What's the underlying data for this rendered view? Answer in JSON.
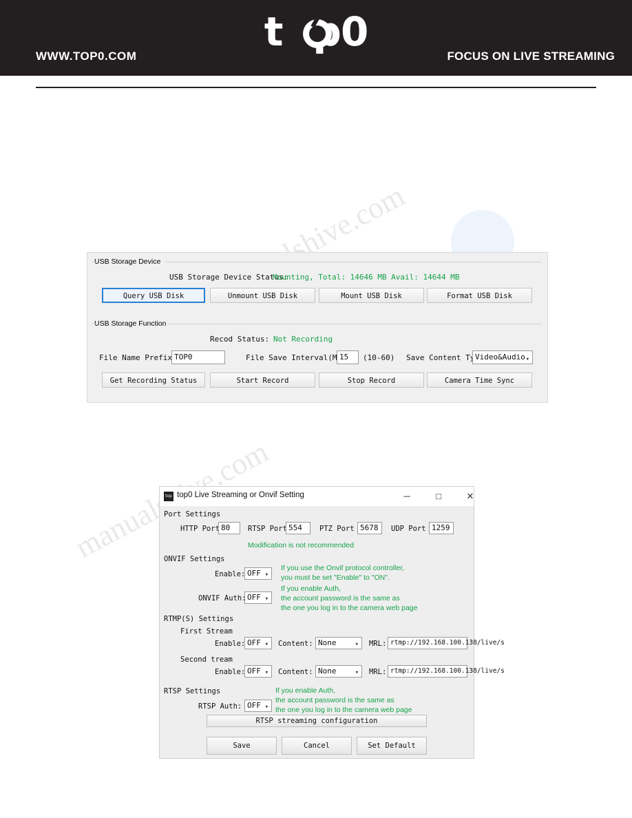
{
  "header": {
    "url": "WWW.TOP0.COM",
    "tagline": "FOCUS ON LIVE STREAMING",
    "logo_left": "t",
    "logo_right": "p0"
  },
  "watermark": {
    "line1": "alshive.com",
    "line2": "manualshive.com"
  },
  "usb_panel": {
    "group1_label": "USB Storage Device",
    "status_label": "USB Storage Device Status:",
    "status_value": "Mounting,  Total:  14646 MB  Avail:  14644 MB",
    "status_color": "#16a34a",
    "buttons": [
      {
        "label": "Query USB Disk",
        "primary": true
      },
      {
        "label": "Unmount USB Disk",
        "primary": false
      },
      {
        "label": "Mount USB Disk",
        "primary": false
      },
      {
        "label": "Format USB Disk",
        "primary": false
      }
    ],
    "group2_label": "USB Storage Function",
    "record_status_label": "Recod Status:",
    "record_status_value": "Not Recording",
    "file_name_prefix_label": "File Name Prefix:",
    "file_name_prefix_value": "TOP0",
    "file_save_interval_label": "File Save Interval(Min):",
    "file_save_interval_value": "15",
    "file_save_interval_range": "(10-60)",
    "save_content_type_label": "Save Content Type:",
    "save_content_type_value": "Video&Audio",
    "buttons2": [
      {
        "label": "Get Recording Status"
      },
      {
        "label": "Start Record"
      },
      {
        "label": "Stop Record"
      },
      {
        "label": "Camera Time Sync"
      }
    ]
  },
  "dialog": {
    "title": "top0 Live Streaming or Onvif Setting",
    "icon_text": "top",
    "minimize": "─",
    "maximize": "□",
    "close": "✕",
    "port_settings_label": "Port Settings",
    "http_port_label": "HTTP Port",
    "http_port_value": "80",
    "rtsp_port_label": "RTSP Port",
    "rtsp_port_value": "554",
    "ptz_port_label": "PTZ Port",
    "ptz_port_value": "5678",
    "udp_port_label": "UDP Port",
    "udp_port_value": "1259",
    "modification_note": "Modification is not recommended",
    "onvif_settings_label": "ONVIF Settings",
    "onvif_enable_label": "Enable:",
    "onvif_enable_value": "OFF",
    "onvif_note1_line1": "If you use the Onvif protocol controller,",
    "onvif_note1_line2": "you must be set \"Enable\" to \"ON\".",
    "onvif_auth_label": "ONVIF Auth:",
    "onvif_auth_value": "OFF",
    "onvif_note2_line1": "If you enable Auth,",
    "onvif_note2_line2": "the account password is the same as",
    "onvif_note2_line3": "the one you log in to the camera web page",
    "rtmp_settings_label": "RTMP(S) Settings",
    "first_stream_label": "First Stream",
    "first_enable_label": "Enable:",
    "first_enable_value": "OFF",
    "first_content_label": "Content:",
    "first_content_value": "None",
    "first_url_label": "MRL:",
    "first_url_value": "rtmp://192.168.100.138/live/s",
    "second_stream_label": "Second tream",
    "second_enable_label": "Enable:",
    "second_enable_value": "OFF",
    "second_content_label": "Content:",
    "second_content_value": "None",
    "second_url_label": "MRL:",
    "second_url_value": "rtmp://192.168.100.138/live/s",
    "rtsp_settings_label": "RTSP Settings",
    "rtsp_auth_label": "RTSP Auth:",
    "rtsp_auth_value": "OFF",
    "rtsp_note_line1": "If you enable Auth,",
    "rtsp_note_line2": "the account password is the same as",
    "rtsp_note_line3": "the one you log in to the camera web page",
    "rtsp_config_button": "RTSP streaming configuration",
    "save_button": "Save",
    "cancel_button": "Cancel",
    "default_button": "Set Default"
  }
}
